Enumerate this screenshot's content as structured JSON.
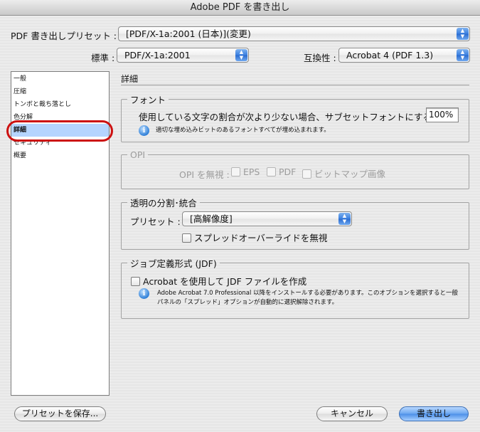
{
  "window": {
    "title": "Adobe PDF を書き出し"
  },
  "preset": {
    "label": "PDF 書き出しプリセット :",
    "value": "[PDF/X-1a:2001 (日本)](変更)"
  },
  "standard": {
    "label": "標準 :",
    "value": "PDF/X-1a:2001"
  },
  "compatibility": {
    "label": "互換性 :",
    "value": "Acrobat 4 (PDF 1.3)"
  },
  "sidebar": {
    "items": [
      {
        "label": "一般"
      },
      {
        "label": "圧縮"
      },
      {
        "label": "トンボと裁ち落とし"
      },
      {
        "label": "色分解"
      },
      {
        "label": "詳細",
        "selected": true
      },
      {
        "label": "セキュリティ"
      },
      {
        "label": "概要"
      }
    ]
  },
  "section": {
    "title": "詳細"
  },
  "fonts": {
    "legend": "フォント",
    "subset_label": "使用している文字の割合が次より少ない場合、サブセットフォントにする :",
    "subset_value": "100%",
    "note": "適切な埋め込みビットのあるフォントすべてが埋め込まれます。"
  },
  "opi": {
    "legend": "OPI",
    "omit_label": "OPI を無視 :",
    "eps": "EPS",
    "pdf": "PDF",
    "bitmap": "ビットマップ画像"
  },
  "transparency": {
    "legend": "透明の分割･統合",
    "preset_label": "プリセット :",
    "preset_value": "[高解像度]",
    "ignore_spread": "スプレッドオーバーライドを無視"
  },
  "jdf": {
    "legend": "ジョブ定義形式 (JDF)",
    "create_label": "Acrobat を使用して JDF ファイルを作成",
    "note_line1": "Adobe Acrobat 7.0 Professional 以降をインストールする必要があります。このオプションを選択すると一般",
    "note_line2": "パネルの「スプレッド」オプションが自動的に選択解除されます。"
  },
  "buttons": {
    "save_preset": "プリセットを保存...",
    "cancel": "キャンセル",
    "export": "書き出し"
  },
  "colors": {
    "selection": "#b5d5ff",
    "highlight_ring": "#cc1111",
    "default_button": "#4b8ee8"
  }
}
